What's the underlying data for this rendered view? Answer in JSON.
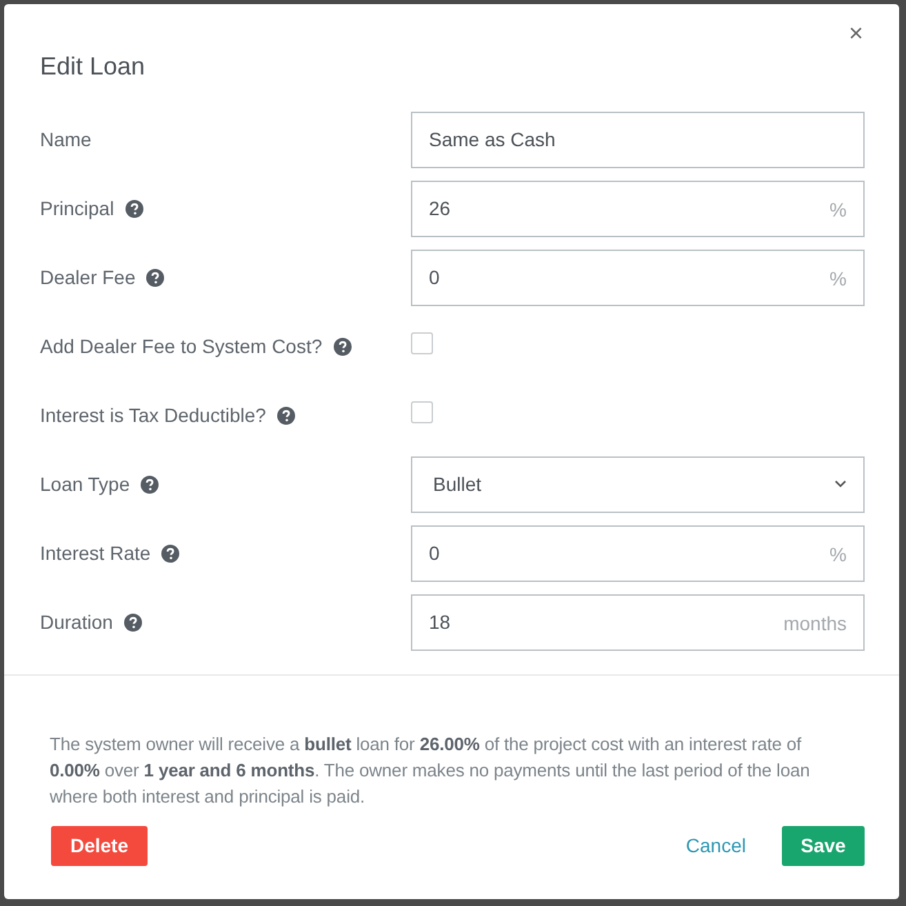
{
  "dialog": {
    "title": "Edit Loan",
    "close": "×"
  },
  "fields": [
    {
      "kind": "text",
      "label": "Name",
      "help": false,
      "value": "Same as Cash"
    },
    {
      "kind": "text",
      "label": "Principal",
      "help": true,
      "value": "26",
      "unit": "%"
    },
    {
      "kind": "text",
      "label": "Dealer Fee",
      "help": true,
      "value": "0",
      "unit": "%"
    },
    {
      "kind": "checkbox",
      "label": "Add Dealer Fee to System Cost?",
      "help": true,
      "checked": false
    },
    {
      "kind": "checkbox",
      "label": "Interest is Tax Deductible?",
      "help": true,
      "checked": false
    },
    {
      "kind": "select",
      "label": "Loan Type",
      "help": true,
      "value": "Bullet"
    },
    {
      "kind": "text",
      "label": "Interest Rate",
      "help": true,
      "value": "0",
      "unit": "%"
    },
    {
      "kind": "text",
      "label": "Duration",
      "help": true,
      "value": "18",
      "unit": "months"
    }
  ],
  "summary": "The system owner will receive a **bullet** loan for **26.00%** of the project cost with an interest rate of **0.00%** over **1 year and 6 months**. The owner makes no payments until the last period of the loan where both interest and principal is paid.",
  "buttons": [
    {
      "kind": "delete",
      "label": "Delete"
    },
    {
      "kind": "cancel",
      "label": "Cancel"
    },
    {
      "kind": "save",
      "label": "Save"
    }
  ]
}
